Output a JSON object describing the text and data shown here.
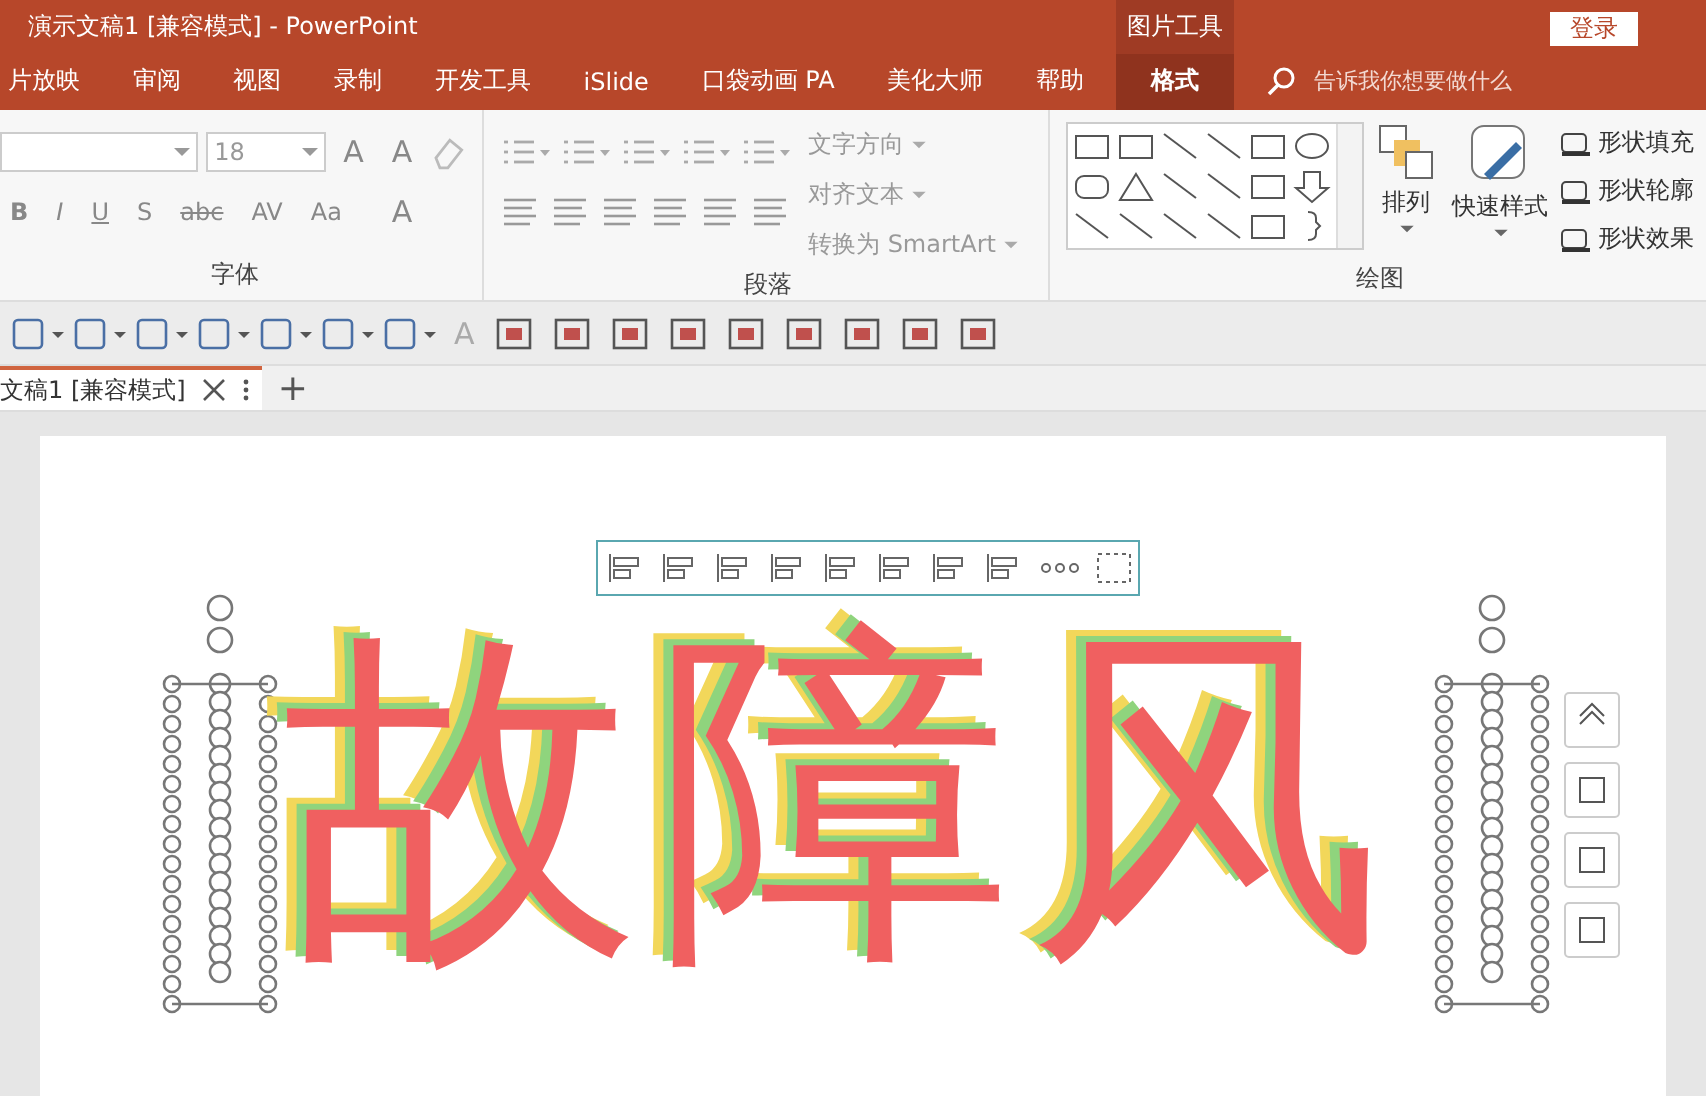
{
  "window": {
    "title": "演示文稿1 [兼容模式]  -  PowerPoint",
    "contextual_group": "图片工具",
    "login_button": "登录"
  },
  "ribbon_tabs": [
    {
      "label": "片放映",
      "selected": false
    },
    {
      "label": "审阅",
      "selected": false
    },
    {
      "label": "视图",
      "selected": false
    },
    {
      "label": "录制",
      "selected": false
    },
    {
      "label": "开发工具",
      "selected": false
    },
    {
      "label": "iSlide",
      "selected": false
    },
    {
      "label": "口袋动画 PA",
      "selected": false
    },
    {
      "label": "美化大师",
      "selected": false
    },
    {
      "label": "帮助",
      "selected": false
    },
    {
      "label": "格式",
      "selected": true
    }
  ],
  "tell_me": {
    "placeholder": "告诉我你想要做什么"
  },
  "font_group": {
    "label": "字体",
    "font_size": "18",
    "size_buttons": [
      "A",
      "A"
    ],
    "format_buttons": [
      "B",
      "I",
      "U",
      "S",
      "abc",
      "AV",
      "Aa",
      "A"
    ]
  },
  "paragraph_group": {
    "label": "段落",
    "commands": [
      "文字方向",
      "对齐文本",
      "转换为 SmartArt"
    ]
  },
  "drawing_group": {
    "label": "绘图",
    "arrange": "排列",
    "quick_styles": "快速样式",
    "commands": [
      "形状填充",
      "形状轮廓",
      "形状效果"
    ]
  },
  "quick_toolbar": {
    "text_button": "A"
  },
  "document_tabs": [
    {
      "label": "文稿1 [兼容模式]",
      "selected": true
    }
  ],
  "new_tab_button": "+",
  "slide": {
    "text": "故障风"
  }
}
